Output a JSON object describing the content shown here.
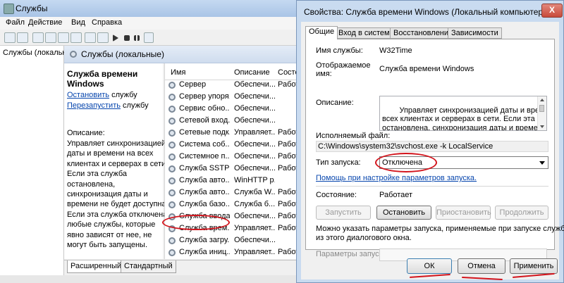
{
  "main_window": {
    "title": "Службы",
    "menu": [
      "Файл",
      "Действие",
      "Вид",
      "Справка"
    ],
    "toolbar_icons": [
      "back-icon",
      "forward-icon",
      "console-tree-icon",
      "properties-icon",
      "refresh-icon",
      "export-icon",
      "help-icon",
      "show-hide-icon",
      "play-icon",
      "stop-icon",
      "pause-icon",
      "restart-icon"
    ],
    "left_tree_label": "Службы (локальные)",
    "header_title": "Службы (локальные)",
    "details": {
      "service_title": "Служба времени Windows",
      "stop_link": "Остановить",
      "stop_suffix": " службу",
      "restart_link": "Перезапустить",
      "restart_suffix": " службу",
      "description_label": "Описание:",
      "description_text": "Управляет синхронизацией\nдаты и времени на всех\nклиентах и серверах в сети.\nЕсли эта служба\nостановлена,\nсинхронизация даты и\nвремени не будет доступна.\nЕсли эта служба отключена,\nлюбые службы, которые\nявно зависят от нее, не\nмогут быть запущены."
    },
    "list": {
      "columns": [
        "Имя",
        "Описание",
        "Состоя"
      ],
      "rows": [
        {
          "name": "Сервер",
          "desc": "Обеспечи...",
          "status": "Работа"
        },
        {
          "name": "Сервер упоря...",
          "desc": "Обеспечи...",
          "status": ""
        },
        {
          "name": "Сервис обно...",
          "desc": "Обеспечи...",
          "status": ""
        },
        {
          "name": "Сетевой вход...",
          "desc": "Обеспечи...",
          "status": ""
        },
        {
          "name": "Сетевые подк...",
          "desc": "Управляет...",
          "status": "Работа"
        },
        {
          "name": "Система соб...",
          "desc": "Обеспечи...",
          "status": "Работа"
        },
        {
          "name": "Системное п...",
          "desc": "Обеспечи...",
          "status": "Работа"
        },
        {
          "name": "Служба SSTP",
          "desc": "Обеспечи...",
          "status": "Работа"
        },
        {
          "name": "Служба авто...",
          "desc": "WinHTTP р...",
          "status": ""
        },
        {
          "name": "Служба авто...",
          "desc": "Служба W...",
          "status": "Работа"
        },
        {
          "name": "Служба базо...",
          "desc": "Служба б...",
          "status": "Работа"
        },
        {
          "name": "Служба вводa...",
          "desc": "Обеспечи...",
          "status": "Работа"
        },
        {
          "name": "Служба врем...",
          "desc": "Управляет...",
          "status": "Работа"
        },
        {
          "name": "Служба загру...",
          "desc": "Обеспечи...",
          "status": ""
        },
        {
          "name": "Служба иниц...",
          "desc": "Управляет...",
          "status": "Работа"
        }
      ]
    },
    "bottom_tabs": [
      "Расширенный",
      "Стандартный"
    ]
  },
  "dialog": {
    "title": "Свойства: Служба времени Windows (Локальный компьютер)",
    "close_label": "X",
    "tabs": [
      "Общие",
      "Вход в систему",
      "Восстановление",
      "Зависимости"
    ],
    "service_name_label": "Имя службы:",
    "service_name_value": "W32Time",
    "display_name_label": "Отображаемое\nимя:",
    "display_name_value": "Служба времени Windows",
    "description_label": "Описание:",
    "description_value": "Управляет синхронизацией даты и времени на\nвсех клиентах и серверах в сети. Если эта служба\nостановлена, синхронизация даты и времени не\nбудет доступна. Если эта служба отключена,",
    "exe_label": "Исполняемый файл:",
    "exe_value": "C:\\Windows\\system32\\svchost.exe -k LocalService",
    "startup_type_label": "Тип запуска:",
    "startup_type_value": "Отключена",
    "help_link": "Помощь при настройке параметров запуска.",
    "status_label": "Состояние:",
    "status_value": "Работает",
    "buttons": {
      "start": "Запустить",
      "stop": "Остановить",
      "pause": "Приостановить",
      "resume": "Продолжить"
    },
    "params_hint": "Можно указать параметры запуска, применяемые при запуске службы\nиз этого диалогового окна.",
    "params_label": "Параметры запуска:",
    "footer": {
      "ok": "ОК",
      "cancel": "Отмена",
      "apply": "Применить"
    }
  },
  "colors": {
    "annotation_red": "#d3141c",
    "link_blue": "#0645ad"
  }
}
